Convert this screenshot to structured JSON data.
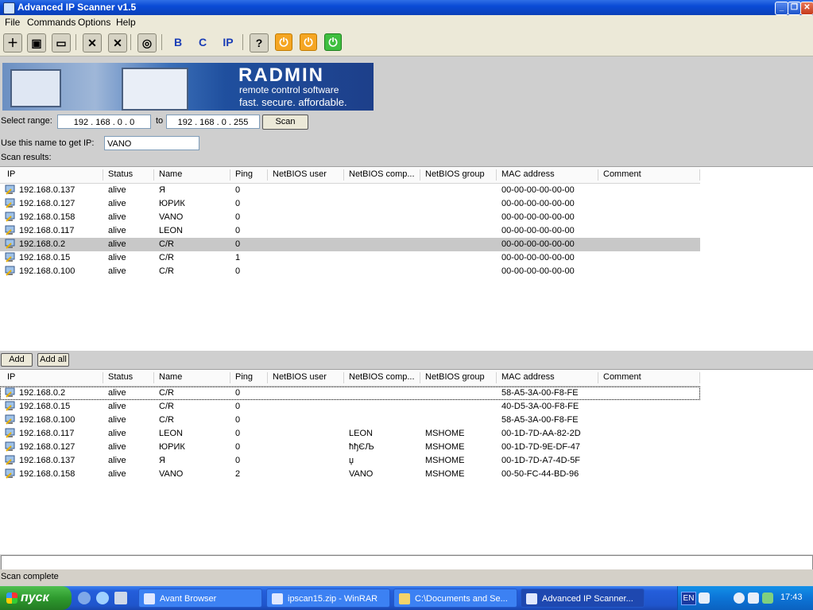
{
  "window": {
    "title": "Advanced IP Scanner v1.5"
  },
  "menu": [
    "File",
    "Commands",
    "Options",
    "Help"
  ],
  "toolbar": {
    "b_label": "B",
    "c_label": "C",
    "ip_label": "IP"
  },
  "banner": {
    "brand": "RADMIN",
    "line2": "remote control software",
    "line3": "fast. secure. affordable."
  },
  "range": {
    "label": "Select range:",
    "from": "192 . 168 .   0  .   0",
    "to_label": "to",
    "to": "192 . 168 .   0  . 255",
    "scan_label": "Scan"
  },
  "name_field": {
    "label": "Use this name to get IP:",
    "value": "VANO"
  },
  "results_label": "Scan results:",
  "columns": [
    "IP",
    "Status",
    "Name",
    "Ping",
    "NetBIOS user",
    "NetBIOS comp...",
    "NetBIOS group",
    "MAC address",
    "Comment"
  ],
  "results": [
    {
      "ip": "192.168.0.137",
      "status": "alive",
      "name": "Я",
      "ping": "0",
      "user": "",
      "comp": "",
      "group": "",
      "mac": "00-00-00-00-00-00"
    },
    {
      "ip": "192.168.0.127",
      "status": "alive",
      "name": "ЮРИК",
      "ping": "0",
      "user": "",
      "comp": "",
      "group": "",
      "mac": "00-00-00-00-00-00"
    },
    {
      "ip": "192.168.0.158",
      "status": "alive",
      "name": "VANO",
      "ping": "0",
      "user": "",
      "comp": "",
      "group": "",
      "mac": "00-00-00-00-00-00"
    },
    {
      "ip": "192.168.0.117",
      "status": "alive",
      "name": "LEON",
      "ping": "0",
      "user": "",
      "comp": "",
      "group": "",
      "mac": "00-00-00-00-00-00"
    },
    {
      "ip": "192.168.0.2",
      "status": "alive",
      "name": "C/R",
      "ping": "0",
      "user": "",
      "comp": "",
      "group": "",
      "mac": "00-00-00-00-00-00"
    },
    {
      "ip": "192.168.0.15",
      "status": "alive",
      "name": "C/R",
      "ping": "1",
      "user": "",
      "comp": "",
      "group": "",
      "mac": "00-00-00-00-00-00"
    },
    {
      "ip": "192.168.0.100",
      "status": "alive",
      "name": "C/R",
      "ping": "0",
      "user": "",
      "comp": "",
      "group": "",
      "mac": "00-00-00-00-00-00"
    }
  ],
  "buttons": {
    "add": "Add",
    "add_all": "Add all"
  },
  "saved": [
    {
      "ip": "192.168.0.2",
      "status": "alive",
      "name": "C/R",
      "ping": "0",
      "user": "",
      "comp": "",
      "group": "",
      "mac": "58-A5-3A-00-F8-FE"
    },
    {
      "ip": "192.168.0.15",
      "status": "alive",
      "name": "C/R",
      "ping": "0",
      "user": "",
      "comp": "",
      "group": "",
      "mac": "40-D5-3A-00-F8-FE"
    },
    {
      "ip": "192.168.0.100",
      "status": "alive",
      "name": "C/R",
      "ping": "0",
      "user": "",
      "comp": "",
      "group": "",
      "mac": "58-A5-3A-00-F8-FE"
    },
    {
      "ip": "192.168.0.117",
      "status": "alive",
      "name": "LEON",
      "ping": "0",
      "user": "",
      "comp": "LEON",
      "group": "MSHOME",
      "mac": "00-1D-7D-AA-82-2D"
    },
    {
      "ip": "192.168.0.127",
      "status": "alive",
      "name": "ЮРИК",
      "ping": "0",
      "user": "",
      "comp": "ћђЄЉ",
      "group": "MSHOME",
      "mac": "00-1D-7D-9E-DF-47"
    },
    {
      "ip": "192.168.0.137",
      "status": "alive",
      "name": "Я",
      "ping": "0",
      "user": "",
      "comp": "џ",
      "group": "MSHOME",
      "mac": "00-1D-7D-A7-4D-5F"
    },
    {
      "ip": "192.168.0.158",
      "status": "alive",
      "name": "VANO",
      "ping": "2",
      "user": "",
      "comp": "VANO",
      "group": "MSHOME",
      "mac": "00-50-FC-44-BD-96"
    }
  ],
  "status": {
    "text": "Scan complete"
  },
  "taskbar": {
    "start": "пуск",
    "items": [
      "Avant Browser",
      "ipscan15.zip - WinRAR",
      "C:\\Documents and Se...",
      "Advanced IP Scanner..."
    ],
    "lang": "EN",
    "clock": "17:43"
  }
}
